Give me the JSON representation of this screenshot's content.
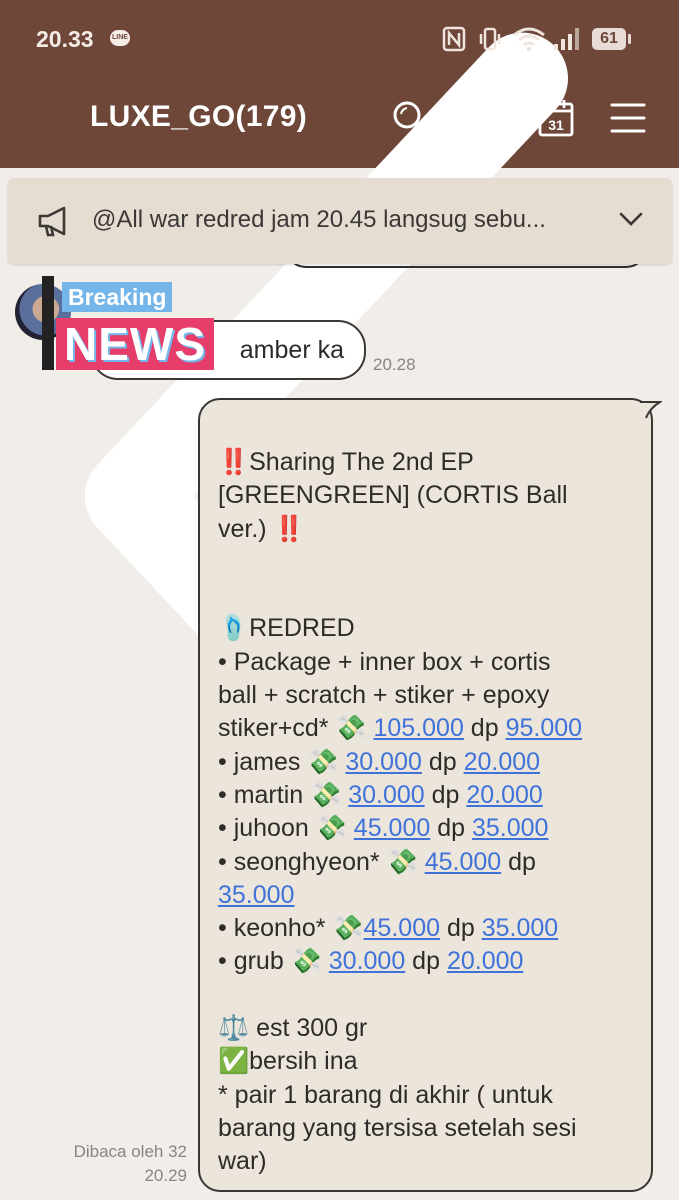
{
  "status": {
    "time": "20.33",
    "battery": "61"
  },
  "topbar": {
    "title": "LUXE_GO(179)"
  },
  "announcement": {
    "text": "@All war redred jam 20.45 langsug sebu..."
  },
  "sticker": {
    "line1": "Breaking",
    "line2": "NEWS"
  },
  "left_message": {
    "text": "amber ka",
    "time": "20.28"
  },
  "right_message": {
    "lines": [
      {
        "t": "‼️Sharing The 2nd EP"
      },
      {
        "t": "[GREENGREEN] (CORTIS Ball"
      },
      {
        "t": "ver.) ‼️"
      },
      {
        "t": ""
      },
      {
        "t": ""
      },
      {
        "t": "🩴REDRED"
      },
      {
        "t": "• Package + inner box + cortis"
      },
      {
        "t": "ball + scratch + stiker + epoxy"
      },
      {
        "pre": "stiker+cd* 💸 ",
        "a": "105.000",
        "mid": " dp ",
        "b": "95.000"
      },
      {
        "pre": "• james 💸 ",
        "a": "30.000",
        "mid": " dp ",
        "b": "20.000"
      },
      {
        "pre": "• martin 💸 ",
        "a": "30.000",
        "mid": " dp ",
        "b": "20.000"
      },
      {
        "pre": "• juhoon 💸 ",
        "a": "45.000",
        "mid": " dp ",
        "b": "35.000"
      },
      {
        "pre": "• seonghyeon* 💸 ",
        "a": "45.000",
        "mid": " dp",
        "b": ""
      },
      {
        "pre": "",
        "a": "35.000",
        "mid": "",
        "b": ""
      },
      {
        "pre": "• keonho* 💸",
        "a": "45.000",
        "mid": " dp ",
        "b": "35.000"
      },
      {
        "pre": "• grub 💸 ",
        "a": "30.000",
        "mid": " dp ",
        "b": "20.000"
      },
      {
        "t": ""
      },
      {
        "t": "⚖️ est 300 gr"
      },
      {
        "t": "✅bersih ina"
      },
      {
        "t": "* pair 1 barang di akhir ( untuk"
      },
      {
        "t": "barang yang tersisa setelah sesi"
      },
      {
        "t": "war)"
      }
    ],
    "read_label": "Dibaca oleh 32",
    "time": "20.29"
  },
  "colors": {
    "header": "#6e4739",
    "background": "#f1ede8",
    "link": "#3f73d9"
  }
}
